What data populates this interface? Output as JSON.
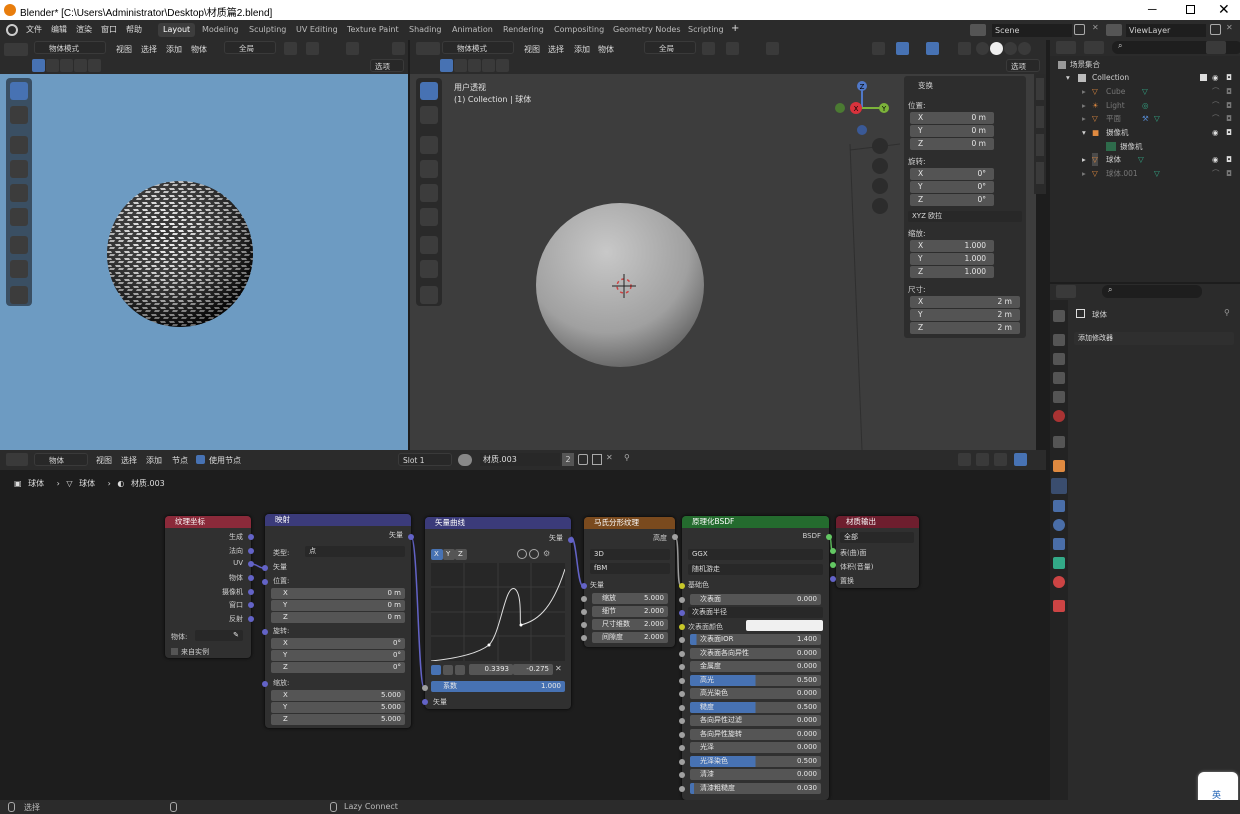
{
  "window": {
    "title": "Blender* [C:\\Users\\Administrator\\Desktop\\材质篇2.blend]"
  },
  "menu": [
    "文件",
    "编辑",
    "渲染",
    "窗口",
    "帮助"
  ],
  "workspaces": [
    "Layout",
    "Modeling",
    "Sculpting",
    "UV Editing",
    "Texture Paint",
    "Shading",
    "Animation",
    "Rendering",
    "Compositing",
    "Geometry Nodes",
    "Scripting"
  ],
  "scene": {
    "name": "Scene",
    "view_layer": "ViewLayer"
  },
  "left_view": {
    "mode": "物体模式",
    "menus": [
      "视图",
      "选择",
      "添加",
      "物体"
    ],
    "pivot": "全局",
    "options": "选项"
  },
  "main_view": {
    "mode": "物体模式",
    "menus": [
      "视图",
      "选择",
      "添加",
      "物体"
    ],
    "pivot": "全局",
    "options": "选项",
    "overlay_line1": "用户透视",
    "overlay_line2": "(1) Collection | 球体"
  },
  "transform": {
    "title": "变换",
    "location_label": "位置:",
    "location": [
      {
        "axis": "X",
        "val": "0 m"
      },
      {
        "axis": "Y",
        "val": "0 m"
      },
      {
        "axis": "Z",
        "val": "0 m"
      }
    ],
    "rotation_label": "旋转:",
    "rotation": [
      {
        "axis": "X",
        "val": "0°"
      },
      {
        "axis": "Y",
        "val": "0°"
      },
      {
        "axis": "Z",
        "val": "0°"
      }
    ],
    "rotation_mode": "XYZ 欧拉",
    "scale_label": "缩放:",
    "scale": [
      {
        "axis": "X",
        "val": "1.000"
      },
      {
        "axis": "Y",
        "val": "1.000"
      },
      {
        "axis": "Z",
        "val": "1.000"
      }
    ],
    "dimensions_label": "尺寸:",
    "dimensions": [
      {
        "axis": "X",
        "val": "2 m"
      },
      {
        "axis": "Y",
        "val": "2 m"
      },
      {
        "axis": "Z",
        "val": "2 m"
      }
    ]
  },
  "outliner": {
    "root": "场景集合",
    "items": [
      {
        "name": "Collection",
        "depth": 1
      },
      {
        "name": "Cube",
        "depth": 2
      },
      {
        "name": "Light",
        "depth": 2
      },
      {
        "name": "平面",
        "depth": 2
      },
      {
        "name": "摄像机",
        "depth": 2
      },
      {
        "name": "摄像机",
        "depth": 3
      },
      {
        "name": "球体",
        "depth": 2
      },
      {
        "name": "球体.001",
        "depth": 2
      }
    ]
  },
  "properties": {
    "object": "球体",
    "add_modifier": "添加修改器"
  },
  "node_editor": {
    "header": {
      "mode": "物体",
      "menus": [
        "视图",
        "选择",
        "添加",
        "节点"
      ],
      "use_nodes": "使用节点",
      "slot": "Slot 1",
      "material": "材质.003",
      "users": "2"
    },
    "breadcrumb": [
      "球体",
      "球体",
      "材质.003"
    ]
  },
  "nodes": {
    "texcoord": {
      "title": "纹理坐标",
      "outputs": [
        "生成",
        "法向",
        "UV",
        "物体",
        "摄像机",
        "窗口",
        "反射"
      ],
      "object_label": "物体:",
      "from_instancer": "来自实例"
    },
    "mapping": {
      "title": "映射",
      "output": "矢量",
      "type_label": "类型:",
      "type": "点",
      "vector": "矢量",
      "loc": "位置:",
      "rot": "旋转:",
      "scale": "缩放:",
      "loc_vals": [
        {
          "axis": "X",
          "val": "0 m"
        },
        {
          "axis": "Y",
          "val": "0 m"
        },
        {
          "axis": "Z",
          "val": "0 m"
        }
      ],
      "rot_vals": [
        {
          "axis": "X",
          "val": "0°"
        },
        {
          "axis": "Y",
          "val": "0°"
        },
        {
          "axis": "Z",
          "val": "0°"
        }
      ],
      "scale_vals": [
        {
          "axis": "X",
          "val": "5.000"
        },
        {
          "axis": "Y",
          "val": "5.000"
        },
        {
          "axis": "Z",
          "val": "5.000"
        }
      ]
    },
    "vcurve": {
      "title": "矢量曲线",
      "output": "矢量",
      "tabs": [
        "X",
        "Y",
        "Z"
      ],
      "pt_x": "0.3393",
      "pt_y": "-0.275",
      "factor": "系数",
      "factor_val": "1.000",
      "input": "矢量"
    },
    "musgrave": {
      "title": "马氏分形纹理",
      "output": "高度",
      "dim": "3D",
      "type": "fBM",
      "vector": "矢量",
      "fields": [
        {
          "label": "缩放",
          "val": "5.000"
        },
        {
          "label": "细节",
          "val": "2.000"
        },
        {
          "label": "尺寸维数",
          "val": "2.000"
        },
        {
          "label": "间隙度",
          "val": "2.000"
        }
      ]
    },
    "bsdf": {
      "title": "原理化BSDF",
      "output": "BSDF",
      "dist": "GGX",
      "sss_method": "随机游走",
      "base_color": "基础色",
      "sss": {
        "label": "次表面",
        "val": "0.000"
      },
      "sss_radius": "次表面半径",
      "sss_color": "次表面颜色",
      "fields": [
        {
          "label": "次表面IOR",
          "val": "1.400"
        },
        {
          "label": "次表面各向异性",
          "val": "0.000"
        },
        {
          "label": "金属度",
          "val": "0.000"
        },
        {
          "label": "高光",
          "val": "0.500"
        },
        {
          "label": "高光染色",
          "val": "0.000"
        },
        {
          "label": "糙度",
          "val": "0.500"
        },
        {
          "label": "各向异性过滤",
          "val": "0.000"
        },
        {
          "label": "各向异性旋转",
          "val": "0.000"
        },
        {
          "label": "光泽",
          "val": "0.000"
        },
        {
          "label": "光泽染色",
          "val": "0.500"
        },
        {
          "label": "清漆",
          "val": "0.000"
        },
        {
          "label": "清漆粗糙度",
          "val": "0.030"
        }
      ]
    },
    "output": {
      "title": "材质输出",
      "target": "全部",
      "inputs": [
        "表(曲)面",
        "体积(音量)",
        "置换"
      ]
    }
  },
  "statusbar": {
    "select": "选择",
    "lazy": "Lazy Connect"
  },
  "ime": {
    "label": "英"
  }
}
